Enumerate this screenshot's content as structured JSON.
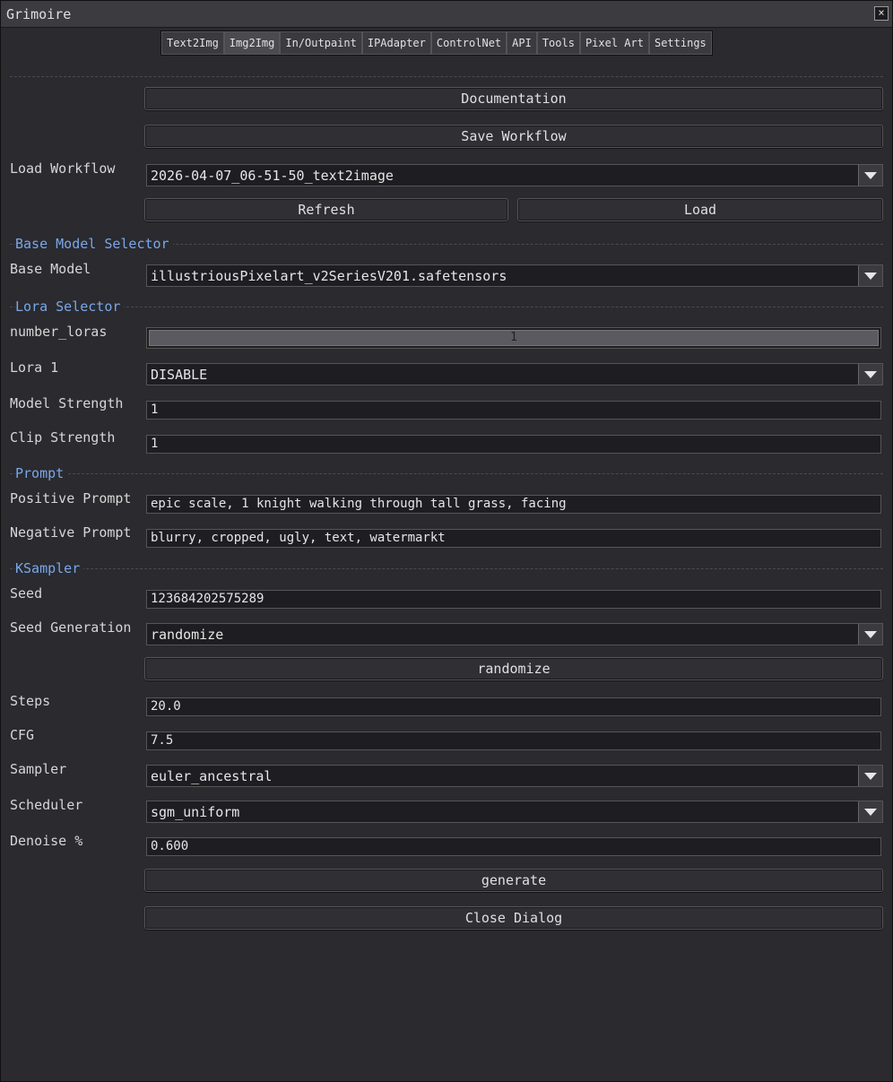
{
  "window": {
    "title": "Grimoire"
  },
  "tabs": [
    {
      "label": "Text2Img"
    },
    {
      "label": "Img2Img"
    },
    {
      "label": "In/Outpaint"
    },
    {
      "label": "IPAdapter"
    },
    {
      "label": "ControlNet"
    },
    {
      "label": "API"
    },
    {
      "label": "Tools"
    },
    {
      "label": "Pixel Art"
    },
    {
      "label": "Settings"
    }
  ],
  "active_tab": "Img2Img",
  "buttons": {
    "documentation": "Documentation",
    "save_workflow": "Save Workflow",
    "refresh": "Refresh",
    "load": "Load",
    "randomize": "randomize",
    "generate": "generate",
    "close_dialog": "Close Dialog"
  },
  "workflow": {
    "label": "Load Workflow",
    "value": "2026-04-07_06-51-50_text2image"
  },
  "sections": {
    "base_model": "Base Model Selector",
    "lora": "Lora Selector",
    "prompt": "Prompt",
    "ksampler": "KSampler"
  },
  "base_model": {
    "label": "Base Model",
    "value": "illustriousPixelart_v2SeriesV201.safetensors"
  },
  "lora": {
    "number_label": "number_loras",
    "number_value": "1",
    "lora1_label": "Lora 1",
    "lora1_value": "DISABLE",
    "model_strength_label": "Model Strength",
    "model_strength_value": "1",
    "clip_strength_label": "Clip Strength",
    "clip_strength_value": "1"
  },
  "prompt": {
    "positive_label": "Positive Prompt",
    "positive_value": "epic scale, 1 knight walking through tall grass, facing",
    "negative_label": "Negative Prompt",
    "negative_value": "blurry, cropped, ugly, text, watermarkt"
  },
  "ksampler": {
    "seed_label": "Seed",
    "seed_value": "123684202575289",
    "seed_gen_label": "Seed Generation",
    "seed_gen_value": "randomize",
    "steps_label": "Steps",
    "steps_value": "20.0",
    "cfg_label": "CFG",
    "cfg_value": "7.5",
    "sampler_label": "Sampler",
    "sampler_value": "euler_ancestral",
    "scheduler_label": "Scheduler",
    "scheduler_value": "sgm_uniform",
    "denoise_label": "Denoise %",
    "denoise_value": "0.600"
  }
}
